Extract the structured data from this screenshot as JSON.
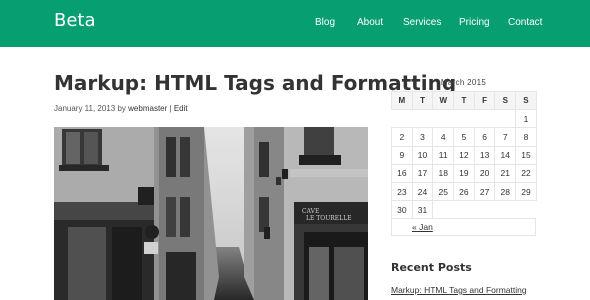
{
  "site": {
    "title": "Beta"
  },
  "nav": {
    "items": [
      "Blog",
      "About",
      "Services",
      "Pricing",
      "Contact"
    ]
  },
  "post": {
    "title": "Markup: HTML Tags and Formatting",
    "date": "January 11, 2013",
    "by": "by",
    "author": "webmaster",
    "separator": "|",
    "edit": "Edit"
  },
  "calendar": {
    "caption": "March 2015",
    "weekdays": [
      "M",
      "T",
      "W",
      "T",
      "F",
      "S",
      "S"
    ],
    "weeks": [
      [
        "",
        "",
        "",
        "",
        "",
        "",
        "1"
      ],
      [
        "2",
        "3",
        "4",
        "5",
        "6",
        "7",
        "8"
      ],
      [
        "9",
        "10",
        "11",
        "12",
        "13",
        "14",
        "15"
      ],
      [
        "16",
        "17",
        "18",
        "19",
        "20",
        "21",
        "22"
      ],
      [
        "23",
        "24",
        "25",
        "26",
        "27",
        "28",
        "29"
      ],
      [
        "30",
        "31",
        "",
        "",
        "",
        "",
        ""
      ]
    ],
    "prev": "« Jan"
  },
  "recent": {
    "title": "Recent Posts",
    "items": [
      "Markup: HTML Tags and Formatting"
    ]
  },
  "colors": {
    "header": "#079e71",
    "header_text": "#ffffff"
  }
}
